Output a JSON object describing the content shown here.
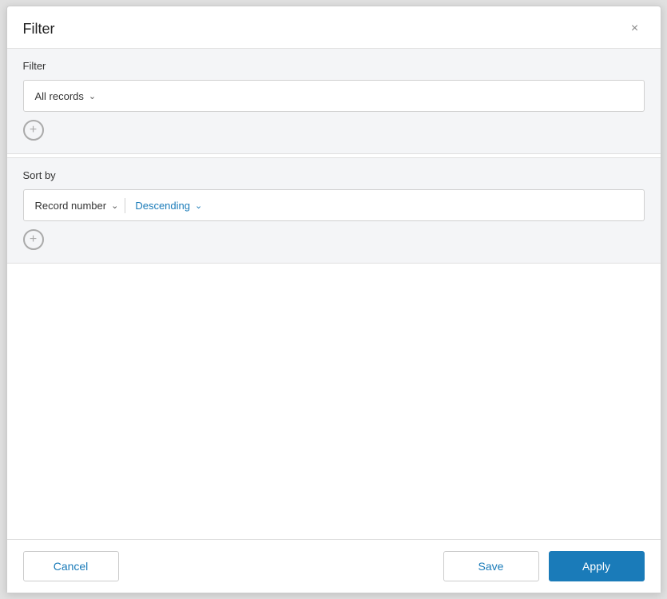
{
  "dialog": {
    "title": "Filter",
    "close_label": "×"
  },
  "filter_section": {
    "label": "Filter",
    "filter_dropdown_value": "All records",
    "add_button_label": "+"
  },
  "sort_section": {
    "label": "Sort by",
    "field_dropdown_value": "Record number",
    "order_dropdown_value": "Descending",
    "add_button_label": "+"
  },
  "footer": {
    "cancel_label": "Cancel",
    "save_label": "Save",
    "apply_label": "Apply"
  }
}
